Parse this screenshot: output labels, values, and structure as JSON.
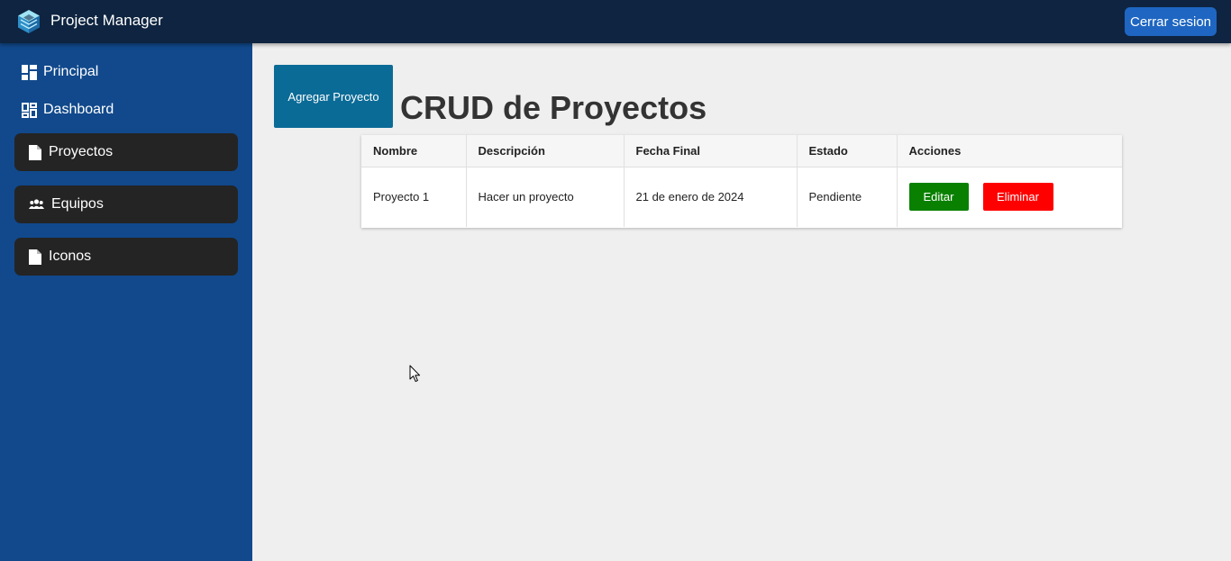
{
  "app": {
    "title": "Project Manager",
    "logout_label": "Cerrar sesion"
  },
  "sidebar": {
    "items": [
      {
        "label": "Principal",
        "icon": "dashboard-grid-icon",
        "style": "plain"
      },
      {
        "label": "Dashboard",
        "icon": "dashboard-outline-icon",
        "style": "plain"
      },
      {
        "label": "Proyectos",
        "icon": "document-icon",
        "style": "card"
      },
      {
        "label": "Equipos",
        "icon": "people-icon",
        "style": "card"
      },
      {
        "label": "Iconos",
        "icon": "document-icon",
        "style": "card"
      }
    ]
  },
  "main": {
    "add_button_label": "Agregar Proyecto",
    "page_title": "CRUD de Proyectos",
    "table": {
      "columns": [
        "Nombre",
        "Descripción",
        "Fecha Final",
        "Estado",
        "Acciones"
      ],
      "rows": [
        {
          "nombre": "Proyecto 1",
          "descripcion": "Hacer un proyecto",
          "fecha_final": "21 de enero de 2024",
          "estado": "Pendiente"
        }
      ],
      "edit_label": "Editar",
      "delete_label": "Eliminar"
    }
  },
  "colors": {
    "topbar": "#0e2440",
    "sidebar": "#11498c",
    "nav_card": "#242424",
    "logout_button": "#1e66c1",
    "add_button": "#0b6b97",
    "edit_button": "#0a8000",
    "delete_button": "#ff0000"
  }
}
